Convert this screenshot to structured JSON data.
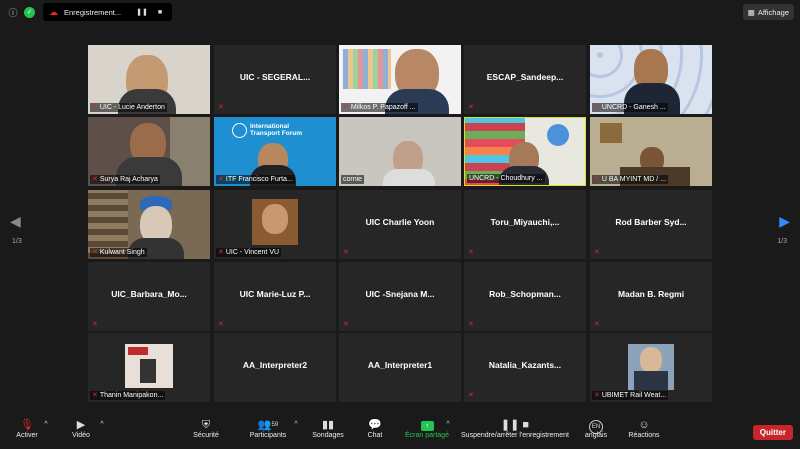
{
  "topbar": {
    "recording_label": "Enregistrement...",
    "view_label": "Affichage"
  },
  "tiles": [
    {
      "label": "UIC - Lucie Anderton",
      "center": ""
    },
    {
      "label": "",
      "center": "UIC - SEGERAL..."
    },
    {
      "label": "Milkos P. Papazoff ...",
      "center": ""
    },
    {
      "label": "",
      "center": "ESCAP_Sandeep..."
    },
    {
      "label": "UNCRD - Ganesh ...",
      "center": ""
    },
    {
      "label": "Surya Raj Acharya",
      "center": ""
    },
    {
      "label": "ITF Francisco Furta...",
      "center": "",
      "banner": "International Transport Forum"
    },
    {
      "label": "cornie",
      "center": ""
    },
    {
      "label": "UNCRD - Choudhury ...",
      "center": ""
    },
    {
      "label": "U BA MYINT MD / ...",
      "center": ""
    },
    {
      "label": "Kulwant Singh",
      "center": ""
    },
    {
      "label": "UIC - Vincent VU",
      "center": ""
    },
    {
      "label": "",
      "center": "UIC Charlie Yoon"
    },
    {
      "label": "",
      "center": "Toru_Miyauchi,..."
    },
    {
      "label": "",
      "center": "Rod Barber Syd..."
    },
    {
      "label": "",
      "center": "UIC_Barbara_Mo..."
    },
    {
      "label": "",
      "center": "UIC Marie-Luz P..."
    },
    {
      "label": "",
      "center": "UIC -Snejana M..."
    },
    {
      "label": "",
      "center": "Rob_Schopman..."
    },
    {
      "label": "",
      "center": "Madan B. Regmi"
    },
    {
      "label": "Thanin Manipakon...",
      "center": ""
    },
    {
      "label": "",
      "center": "AA_Interpreter2"
    },
    {
      "label": "",
      "center": "AA_Interpreter1"
    },
    {
      "label": "",
      "center": "Natalia_Kazants..."
    },
    {
      "label": "UBIMET Rail Weat...",
      "center": ""
    }
  ],
  "paging": {
    "left": "1/3",
    "right": "1/3"
  },
  "toolbar": {
    "mute": "Activer",
    "video": "Vidéo",
    "security": "Sécurité",
    "participants": "Participants",
    "participants_count": "59",
    "polls": "Sondages",
    "chat": "Chat",
    "share": "Écran partagé",
    "record": "Suspendre/arrêter l'enregistrement",
    "lang_code": "EN",
    "lang": "anglais",
    "reactions": "Réactions",
    "quit": "Quitter"
  },
  "colors": {
    "share_green": "#23c552",
    "quit_red": "#c8262a",
    "muted_red": "#e02828"
  }
}
